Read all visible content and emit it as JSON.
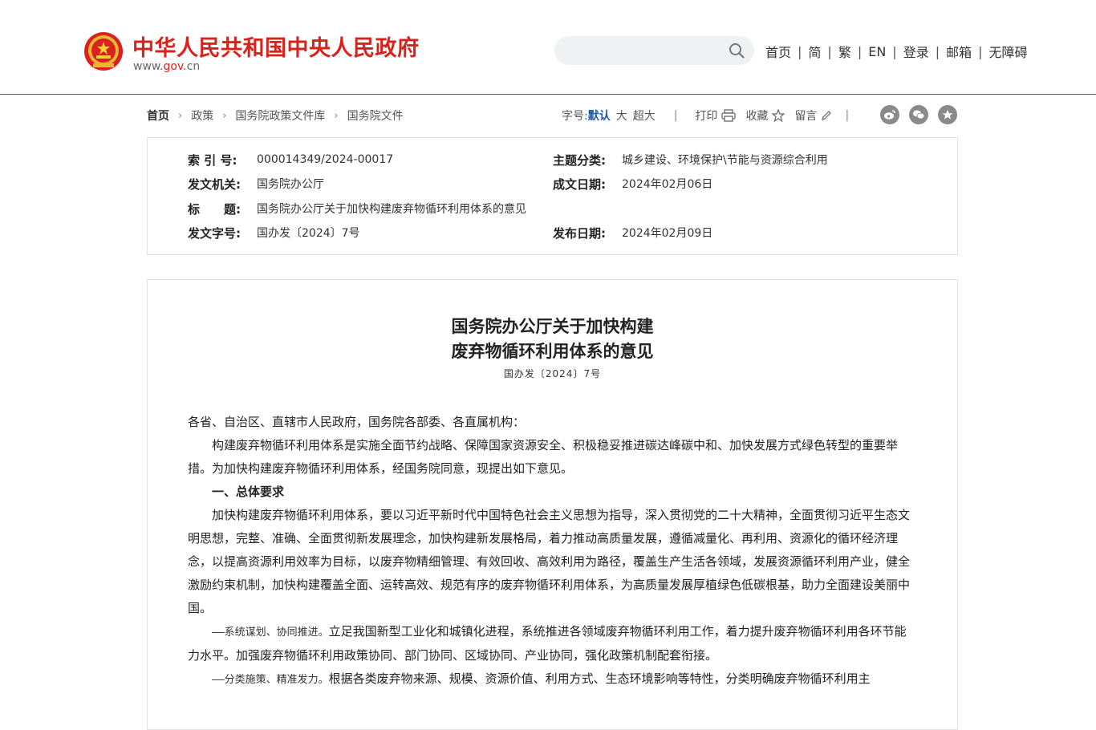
{
  "header": {
    "site_title": "中华人民共和国中央人民政府",
    "domain_prefix": "www.",
    "domain_gov": "gov",
    "domain_suffix": ".cn",
    "search": {
      "placeholder": "",
      "value": ""
    },
    "nav": [
      "首页",
      "简",
      "繁",
      "EN",
      "登录",
      "邮箱",
      "无障碍"
    ]
  },
  "breadcrumb": [
    "首页",
    "政策",
    "国务院政策文件库",
    "国务院文件"
  ],
  "toolbar": {
    "font_size_label": "字号:",
    "font_default": "默认",
    "font_large": "大",
    "font_xlarge": "超大",
    "print": "打印",
    "favorite": "收藏",
    "comment": "留言",
    "separator": "|"
  },
  "share_icons": [
    "weibo-icon",
    "wechat-icon",
    "qzone-icon"
  ],
  "meta": {
    "index_no_label": "索 引 号:",
    "index_no": "000014349/2024-00017",
    "topic_label": "主题分类:",
    "topic": "城乡建设、环境保护\\节能与资源综合利用",
    "issuer_label": "发文机关:",
    "issuer": "国务院办公厅",
    "written_date_label": "成文日期:",
    "written_date": "2024年02月06日",
    "title_label": "标　　题:",
    "title": "国务院办公厅关于加快构建废弃物循环利用体系的意见",
    "doc_no_label": "发文字号:",
    "doc_no": "国办发〔2024〕7号",
    "publish_date_label": "发布日期:",
    "publish_date": "2024年02月09日"
  },
  "article": {
    "title_line1": "国务院办公厅关于加快构建",
    "title_line2": "废弃物循环利用体系的意见",
    "doc_no": "国办发〔2024〕7号",
    "salutation": "各省、自治区、直辖市人民政府，国务院各部委、各直属机构：",
    "intro": "构建废弃物循环利用体系是实施全面节约战略、保障国家资源安全、积极稳妥推进碳达峰碳中和、加快发展方式绿色转型的重要举措。为加快构建废弃物循环利用体系，经国务院同意，现提出如下意见。",
    "section1_heading": "一、总体要求",
    "section1_body": "加快构建废弃物循环利用体系，要以习近平新时代中国特色社会主义思想为指导，深入贯彻党的二十大精神，全面贯彻习近平生态文明思想，完整、准确、全面贯彻新发展理念，加快构建新发展格局，着力推动高质量发展，遵循减量化、再利用、资源化的循环经济理念，以提高资源利用效率为目标，以废弃物精细管理、有效回收、高效利用为路径，覆盖生产生活各领域，发展资源循环利用产业，健全激励约束机制，加快构建覆盖全面、运转高效、规范有序的废弃物循环利用体系，为高质量发展厚植绿色低碳根基，助力全面建设美丽中国。",
    "principle1_title": "——系统谋划、协同推进。",
    "principle1_body": "立足我国新型工业化和城镇化进程，系统推进各领域废弃物循环利用工作，着力提升废弃物循环利用各环节能力水平。加强废弃物循环利用政策协同、部门协同、区域协同、产业协同，强化政策机制配套衔接。",
    "principle2_title": "——分类施策、精准发力。",
    "principle2_body": "根据各类废弃物来源、规模、资源价值、利用方式、生态环境影响等特性，分类明确废弃物循环利用主"
  }
}
